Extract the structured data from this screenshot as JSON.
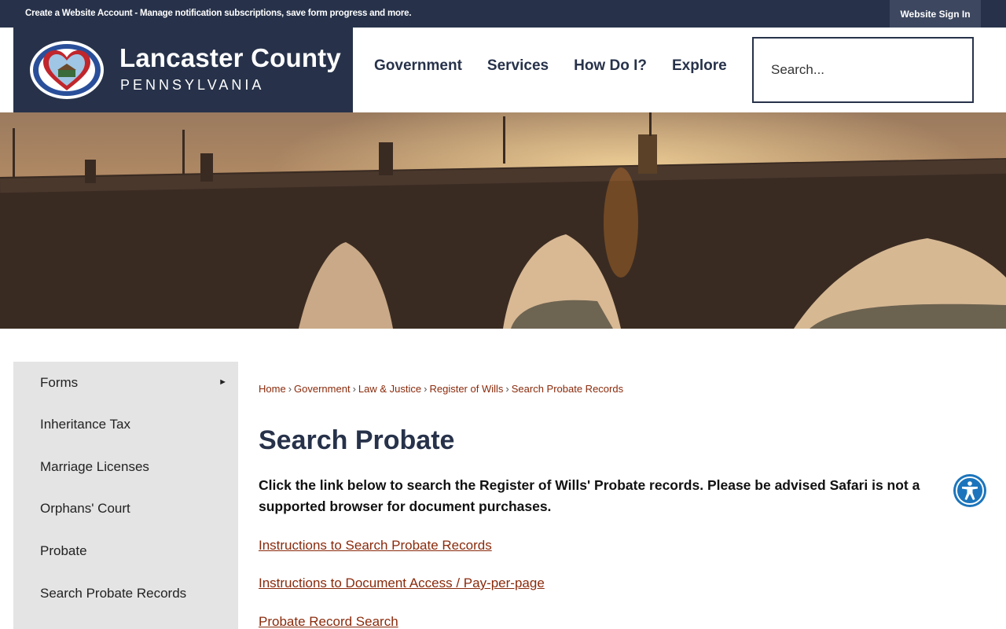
{
  "topbar": {
    "message": "Create a Website Account - Manage notification subscriptions, save form progress and more.",
    "signin_label": "Website Sign In"
  },
  "brand": {
    "name": "Lancaster County",
    "state": "PENNSYLVANIA"
  },
  "nav": {
    "items": [
      {
        "label": "Government"
      },
      {
        "label": "Services"
      },
      {
        "label": "How Do I?"
      },
      {
        "label": "Explore"
      }
    ]
  },
  "search": {
    "placeholder": "Search..."
  },
  "sidebar": {
    "items": [
      {
        "label": "Forms",
        "has_submenu": true
      },
      {
        "label": "Inheritance Tax"
      },
      {
        "label": "Marriage Licenses"
      },
      {
        "label": "Orphans' Court"
      },
      {
        "label": "Probate"
      },
      {
        "label": "Search Probate Records"
      }
    ],
    "submenu_arrow": "►"
  },
  "breadcrumb": {
    "items": [
      "Home",
      "Government",
      "Law & Justice",
      "Register of Wills",
      "Search Probate Records"
    ],
    "separator": "›"
  },
  "main": {
    "title": "Search Probate",
    "intro": "Click the link below to search the Register of Wills' Probate records. Please be advised Safari is not a supported browser for document purchases.",
    "links": [
      {
        "label": "Instructions to Search Probate Records"
      },
      {
        "label": "Instructions to Document Access / Pay-per-page"
      },
      {
        "label": "Probate Record Search"
      }
    ]
  },
  "colors": {
    "navy": "#27324a",
    "link": "#8a2a0b",
    "sidebar_bg": "#e4e4e4",
    "accessibility_blue": "#1c75bc"
  },
  "icons": {
    "seal": "county-seal-icon",
    "accessibility": "accessibility-icon"
  }
}
